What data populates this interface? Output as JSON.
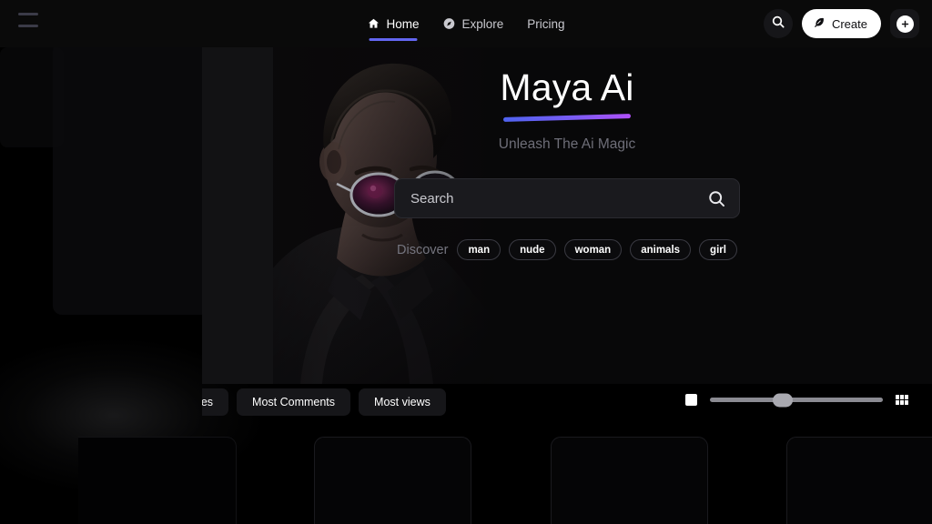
{
  "topbar": {
    "menu_icon": "hamburger-icon",
    "nav": [
      {
        "label": "Home",
        "icon": "home-icon",
        "active": true
      },
      {
        "label": "Explore",
        "icon": "compass-icon",
        "active": false
      },
      {
        "label": "Pricing",
        "icon": "",
        "active": false
      }
    ],
    "search_icon": "search-icon",
    "create_label": "Create",
    "create_icon": "feather-icon",
    "add_icon": "plus-icon"
  },
  "hero": {
    "title": "Maya Ai",
    "subtitle": "Unleash The Ai Magic",
    "search": {
      "placeholder": "Search",
      "value": "",
      "icon": "search-icon"
    },
    "discover_label": "Discover",
    "tags": [
      "man",
      "nude",
      "woman",
      "animals",
      "girl"
    ]
  },
  "filterbar": {
    "chips": [
      "ost votes",
      "Most Comments",
      "Most views"
    ],
    "view": {
      "single_icon": "square-view-icon",
      "grid_icon": "grid-view-icon",
      "slider_value": 42
    }
  },
  "colors": {
    "accent_indigo": "#6366f1",
    "gradient_start": "#4f63f0",
    "gradient_end": "#b050f8",
    "background": "#000000",
    "surface": "#161619"
  }
}
